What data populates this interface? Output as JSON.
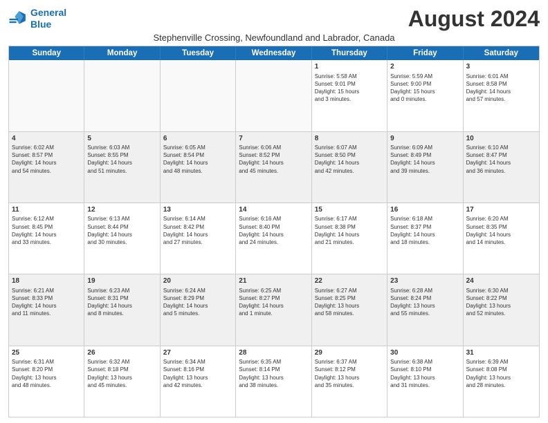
{
  "logo": {
    "line1": "General",
    "line2": "Blue"
  },
  "title": "August 2024",
  "subtitle": "Stephenville Crossing, Newfoundland and Labrador, Canada",
  "days": [
    "Sunday",
    "Monday",
    "Tuesday",
    "Wednesday",
    "Thursday",
    "Friday",
    "Saturday"
  ],
  "rows": [
    [
      {
        "day": "",
        "info": ""
      },
      {
        "day": "",
        "info": ""
      },
      {
        "day": "",
        "info": ""
      },
      {
        "day": "",
        "info": ""
      },
      {
        "day": "1",
        "info": "Sunrise: 5:58 AM\nSunset: 9:01 PM\nDaylight: 15 hours\nand 3 minutes."
      },
      {
        "day": "2",
        "info": "Sunrise: 5:59 AM\nSunset: 9:00 PM\nDaylight: 15 hours\nand 0 minutes."
      },
      {
        "day": "3",
        "info": "Sunrise: 6:01 AM\nSunset: 8:58 PM\nDaylight: 14 hours\nand 57 minutes."
      }
    ],
    [
      {
        "day": "4",
        "info": "Sunrise: 6:02 AM\nSunset: 8:57 PM\nDaylight: 14 hours\nand 54 minutes."
      },
      {
        "day": "5",
        "info": "Sunrise: 6:03 AM\nSunset: 8:55 PM\nDaylight: 14 hours\nand 51 minutes."
      },
      {
        "day": "6",
        "info": "Sunrise: 6:05 AM\nSunset: 8:54 PM\nDaylight: 14 hours\nand 48 minutes."
      },
      {
        "day": "7",
        "info": "Sunrise: 6:06 AM\nSunset: 8:52 PM\nDaylight: 14 hours\nand 45 minutes."
      },
      {
        "day": "8",
        "info": "Sunrise: 6:07 AM\nSunset: 8:50 PM\nDaylight: 14 hours\nand 42 minutes."
      },
      {
        "day": "9",
        "info": "Sunrise: 6:09 AM\nSunset: 8:49 PM\nDaylight: 14 hours\nand 39 minutes."
      },
      {
        "day": "10",
        "info": "Sunrise: 6:10 AM\nSunset: 8:47 PM\nDaylight: 14 hours\nand 36 minutes."
      }
    ],
    [
      {
        "day": "11",
        "info": "Sunrise: 6:12 AM\nSunset: 8:45 PM\nDaylight: 14 hours\nand 33 minutes."
      },
      {
        "day": "12",
        "info": "Sunrise: 6:13 AM\nSunset: 8:44 PM\nDaylight: 14 hours\nand 30 minutes."
      },
      {
        "day": "13",
        "info": "Sunrise: 6:14 AM\nSunset: 8:42 PM\nDaylight: 14 hours\nand 27 minutes."
      },
      {
        "day": "14",
        "info": "Sunrise: 6:16 AM\nSunset: 8:40 PM\nDaylight: 14 hours\nand 24 minutes."
      },
      {
        "day": "15",
        "info": "Sunrise: 6:17 AM\nSunset: 8:38 PM\nDaylight: 14 hours\nand 21 minutes."
      },
      {
        "day": "16",
        "info": "Sunrise: 6:18 AM\nSunset: 8:37 PM\nDaylight: 14 hours\nand 18 minutes."
      },
      {
        "day": "17",
        "info": "Sunrise: 6:20 AM\nSunset: 8:35 PM\nDaylight: 14 hours\nand 14 minutes."
      }
    ],
    [
      {
        "day": "18",
        "info": "Sunrise: 6:21 AM\nSunset: 8:33 PM\nDaylight: 14 hours\nand 11 minutes."
      },
      {
        "day": "19",
        "info": "Sunrise: 6:23 AM\nSunset: 8:31 PM\nDaylight: 14 hours\nand 8 minutes."
      },
      {
        "day": "20",
        "info": "Sunrise: 6:24 AM\nSunset: 8:29 PM\nDaylight: 14 hours\nand 5 minutes."
      },
      {
        "day": "21",
        "info": "Sunrise: 6:25 AM\nSunset: 8:27 PM\nDaylight: 14 hours\nand 1 minute."
      },
      {
        "day": "22",
        "info": "Sunrise: 6:27 AM\nSunset: 8:25 PM\nDaylight: 13 hours\nand 58 minutes."
      },
      {
        "day": "23",
        "info": "Sunrise: 6:28 AM\nSunset: 8:24 PM\nDaylight: 13 hours\nand 55 minutes."
      },
      {
        "day": "24",
        "info": "Sunrise: 6:30 AM\nSunset: 8:22 PM\nDaylight: 13 hours\nand 52 minutes."
      }
    ],
    [
      {
        "day": "25",
        "info": "Sunrise: 6:31 AM\nSunset: 8:20 PM\nDaylight: 13 hours\nand 48 minutes."
      },
      {
        "day": "26",
        "info": "Sunrise: 6:32 AM\nSunset: 8:18 PM\nDaylight: 13 hours\nand 45 minutes."
      },
      {
        "day": "27",
        "info": "Sunrise: 6:34 AM\nSunset: 8:16 PM\nDaylight: 13 hours\nand 42 minutes."
      },
      {
        "day": "28",
        "info": "Sunrise: 6:35 AM\nSunset: 8:14 PM\nDaylight: 13 hours\nand 38 minutes."
      },
      {
        "day": "29",
        "info": "Sunrise: 6:37 AM\nSunset: 8:12 PM\nDaylight: 13 hours\nand 35 minutes."
      },
      {
        "day": "30",
        "info": "Sunrise: 6:38 AM\nSunset: 8:10 PM\nDaylight: 13 hours\nand 31 minutes."
      },
      {
        "day": "31",
        "info": "Sunrise: 6:39 AM\nSunset: 8:08 PM\nDaylight: 13 hours\nand 28 minutes."
      }
    ]
  ]
}
